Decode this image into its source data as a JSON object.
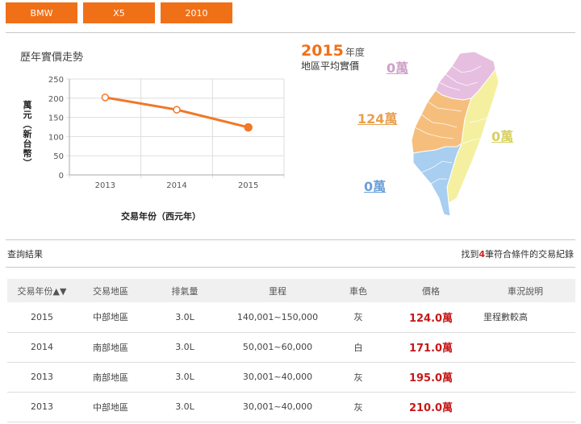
{
  "tabs": [
    "BMW",
    "X5",
    "2010"
  ],
  "trend": {
    "title": "歷年實價走勢",
    "ylabel_chars": [
      "萬",
      "元",
      "︵",
      "新",
      "台",
      "幣",
      "︶"
    ],
    "xlabel": "交易年份（西元年）"
  },
  "chart_data": {
    "type": "line",
    "title": "歷年實價走勢",
    "xlabel": "交易年份（西元年）",
    "ylabel": "萬元（新台幣）",
    "categories": [
      "2013",
      "2014",
      "2015"
    ],
    "values": [
      202,
      170,
      124
    ],
    "ylim": [
      0,
      250
    ],
    "yticks": [
      0,
      50,
      100,
      150,
      200,
      250
    ],
    "grid": true,
    "color": "#f07828"
  },
  "region_summary": {
    "year": "2015",
    "year_unit": "年度",
    "subtitle": "地區平均實價",
    "north": "0萬",
    "central": "124萬",
    "east": "0萬",
    "south": "0萬",
    "colors": {
      "north": "#e6bfe0",
      "central": "#f6be7c",
      "east": "#f4f0a0",
      "south": "#a8cef0"
    }
  },
  "results": {
    "label": "查詢結果",
    "count_prefix": "找到",
    "count": "4",
    "count_suffix": "筆符合條件的交易紀錄"
  },
  "table": {
    "headers": [
      "交易年份▲▼",
      "交易地區",
      "排氣量",
      "里程",
      "車色",
      "價格",
      "車況說明"
    ],
    "rows": [
      [
        "2015",
        "中部地區",
        "3.0L",
        "140,001~150,000",
        "灰",
        "124.0萬",
        "里程數較高"
      ],
      [
        "2014",
        "南部地區",
        "3.0L",
        "50,001~60,000",
        "白",
        "171.0萬",
        ""
      ],
      [
        "2013",
        "南部地區",
        "3.0L",
        "30,001~40,000",
        "灰",
        "195.0萬",
        ""
      ],
      [
        "2013",
        "中部地區",
        "3.0L",
        "30,001~40,000",
        "灰",
        "210.0萬",
        ""
      ]
    ]
  }
}
